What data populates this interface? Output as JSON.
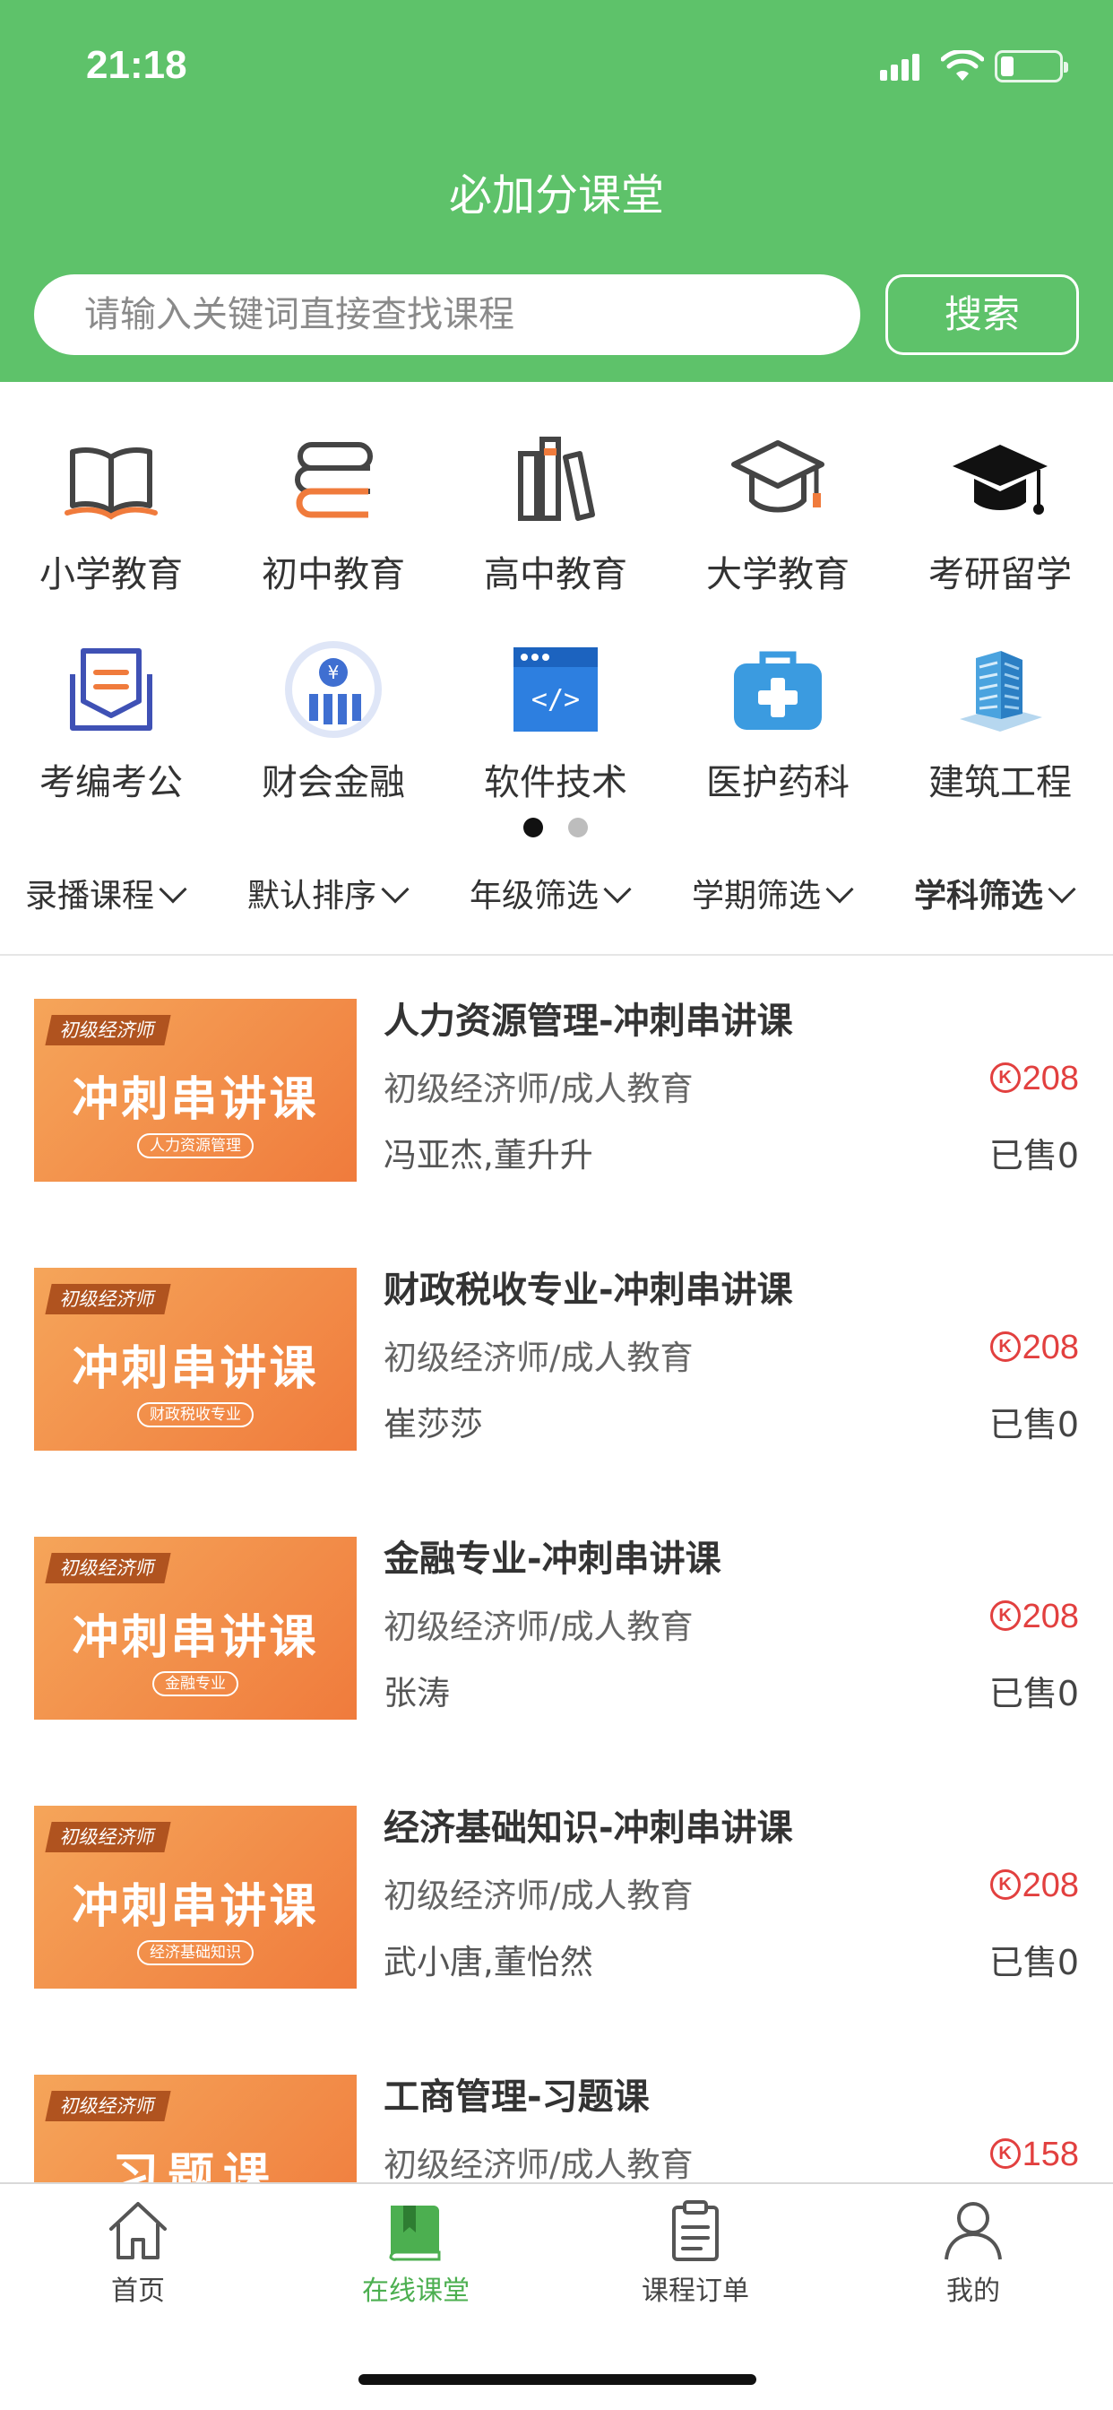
{
  "status_bar": {
    "time": "21:18"
  },
  "header": {
    "title": "必加分课堂",
    "search_placeholder": "请输入关键词直接查找课程",
    "search_button": "搜索",
    "background_color": "#5ec26a"
  },
  "categories": [
    {
      "label": "小学教育",
      "icon": "open-book-icon"
    },
    {
      "label": "初中教育",
      "icon": "book-stack-icon"
    },
    {
      "label": "高中教育",
      "icon": "bookshelf-icon"
    },
    {
      "label": "大学教育",
      "icon": "graduation-cap-outline-icon"
    },
    {
      "label": "考研留学",
      "icon": "graduation-cap-icon"
    },
    {
      "label": "考编考公",
      "icon": "document-shield-icon"
    },
    {
      "label": "财会金融",
      "icon": "finance-yuan-icon"
    },
    {
      "label": "软件技术",
      "icon": "code-window-icon"
    },
    {
      "label": "医护药科",
      "icon": "medical-kit-icon"
    },
    {
      "label": "建筑工程",
      "icon": "building-icon"
    }
  ],
  "pager": {
    "pages": 2,
    "active_page": 1
  },
  "filters": [
    "录播课程",
    "默认排序",
    "年级筛选",
    "学期筛选",
    "学科筛选"
  ],
  "courses": [
    {
      "thumb_tag": "初级经济师",
      "thumb_title": "冲刺串讲课",
      "thumb_sub": "人力资源管理",
      "title": "人力资源管理-冲刺串讲课",
      "category": "初级经济师/成人教育",
      "teacher": "冯亚杰,董升升",
      "price": "208",
      "sold": "已售0"
    },
    {
      "thumb_tag": "初级经济师",
      "thumb_title": "冲刺串讲课",
      "thumb_sub": "财政税收专业",
      "title": "财政税收专业-冲刺串讲课",
      "category": "初级经济师/成人教育",
      "teacher": "崔莎莎",
      "price": "208",
      "sold": "已售0"
    },
    {
      "thumb_tag": "初级经济师",
      "thumb_title": "冲刺串讲课",
      "thumb_sub": "金融专业",
      "title": "金融专业-冲刺串讲课",
      "category": "初级经济师/成人教育",
      "teacher": "张涛",
      "price": "208",
      "sold": "已售0"
    },
    {
      "thumb_tag": "初级经济师",
      "thumb_title": "冲刺串讲课",
      "thumb_sub": "经济基础知识",
      "title": "经济基础知识-冲刺串讲课",
      "category": "初级经济师/成人教育",
      "teacher": "武小唐,董怡然",
      "price": "208",
      "sold": "已售0"
    },
    {
      "thumb_tag": "初级经济师",
      "thumb_title": "习题课",
      "thumb_sub": "",
      "title": "工商管理-习题课",
      "category": "初级经济师/成人教育",
      "teacher": "",
      "price": "158",
      "sold": ""
    }
  ],
  "price_coin": "K",
  "tabbar": [
    {
      "label": "首页",
      "icon": "home-icon",
      "active": false
    },
    {
      "label": "在线课堂",
      "icon": "green-book-icon",
      "active": true
    },
    {
      "label": "课程订单",
      "icon": "clipboard-icon",
      "active": false
    },
    {
      "label": "我的",
      "icon": "user-icon",
      "active": false
    }
  ],
  "colors": {
    "accent": "#5ec26a",
    "price": "#e2403f",
    "active_tab": "#4caf50"
  }
}
